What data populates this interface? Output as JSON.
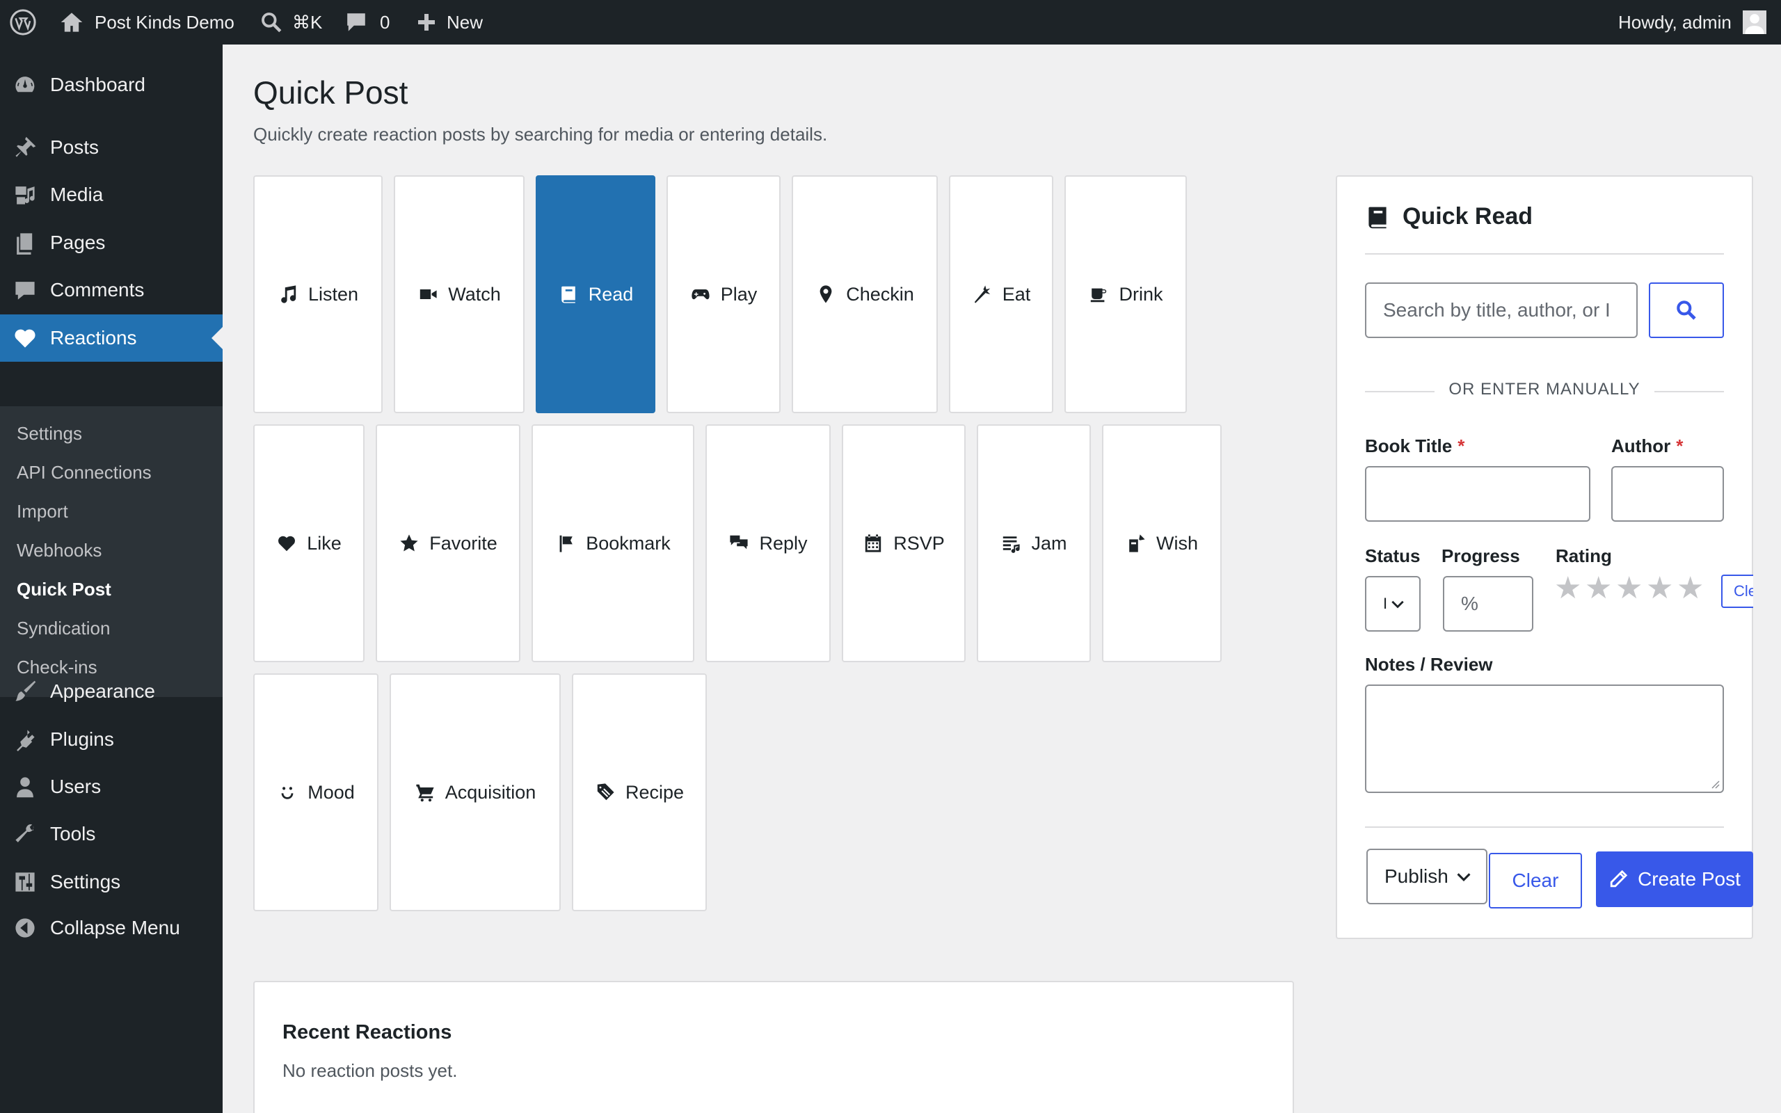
{
  "admin_bar": {
    "site_name": "Post Kinds Demo",
    "shortcut": "⌘K",
    "comments_count": "0",
    "new_label": "New",
    "greeting": "Howdy, admin"
  },
  "sidebar": {
    "items": [
      {
        "label": "Dashboard",
        "icon": "dashboard-icon"
      },
      {
        "label": "Posts",
        "icon": "pin-icon"
      },
      {
        "label": "Media",
        "icon": "media-icon"
      },
      {
        "label": "Pages",
        "icon": "pages-icon"
      },
      {
        "label": "Comments",
        "icon": "comment-icon"
      },
      {
        "label": "Reactions",
        "icon": "heart-icon"
      },
      {
        "label": "Appearance",
        "icon": "brush-icon"
      },
      {
        "label": "Plugins",
        "icon": "plugin-icon"
      },
      {
        "label": "Users",
        "icon": "user-icon"
      },
      {
        "label": "Tools",
        "icon": "wrench-icon"
      },
      {
        "label": "Settings",
        "icon": "sliders-icon"
      },
      {
        "label": "Collapse Menu",
        "icon": "collapse-icon"
      }
    ],
    "submenu": [
      "Settings",
      "API Connections",
      "Import",
      "Webhooks",
      "Quick Post",
      "Syndication",
      "Check-ins"
    ],
    "active_submenu": "Quick Post"
  },
  "main": {
    "title": "Quick Post",
    "description": "Quickly create reaction posts by searching for media or entering details."
  },
  "kinds": [
    {
      "label": "Listen",
      "icon": "music-note-icon"
    },
    {
      "label": "Watch",
      "icon": "video-camera-icon"
    },
    {
      "label": "Read",
      "icon": "book-icon",
      "selected": true
    },
    {
      "label": "Play",
      "icon": "gamepad-icon"
    },
    {
      "label": "Checkin",
      "icon": "location-pin-icon"
    },
    {
      "label": "Eat",
      "icon": "carrot-icon"
    },
    {
      "label": "Drink",
      "icon": "coffee-icon"
    },
    {
      "label": "Like",
      "icon": "heart-icon"
    },
    {
      "label": "Favorite",
      "icon": "star-icon"
    },
    {
      "label": "Bookmark",
      "icon": "flag-icon"
    },
    {
      "label": "Reply",
      "icon": "speech-bubbles-icon"
    },
    {
      "label": "RSVP",
      "icon": "calendar-icon"
    },
    {
      "label": "Jam",
      "icon": "playlist-icon"
    },
    {
      "label": "Wish",
      "icon": "wish-icon"
    },
    {
      "label": "Mood",
      "icon": "smiley-icon"
    },
    {
      "label": "Acquisition",
      "icon": "cart-icon"
    },
    {
      "label": "Recipe",
      "icon": "recipe-icon"
    }
  ],
  "quick_panel": {
    "title": "Quick Read",
    "search_placeholder": "Search by title, author, or I",
    "divider_text": "OR ENTER MANUALLY",
    "book_title_label": "Book Title",
    "author_label": "Author",
    "required_mark": "*",
    "status_label": "Status",
    "status_value": "I",
    "progress_label": "Progress",
    "progress_placeholder": "%",
    "rating_label": "Rating",
    "rating_value": 0,
    "rating_max": 5,
    "rating_clear": "Clear",
    "notes_label": "Notes / Review",
    "publish_select": "Publish",
    "clear_button": "Clear",
    "create_button": "Create Post"
  },
  "recent": {
    "title": "Recent Reactions",
    "empty_text": "No reaction posts yet."
  }
}
